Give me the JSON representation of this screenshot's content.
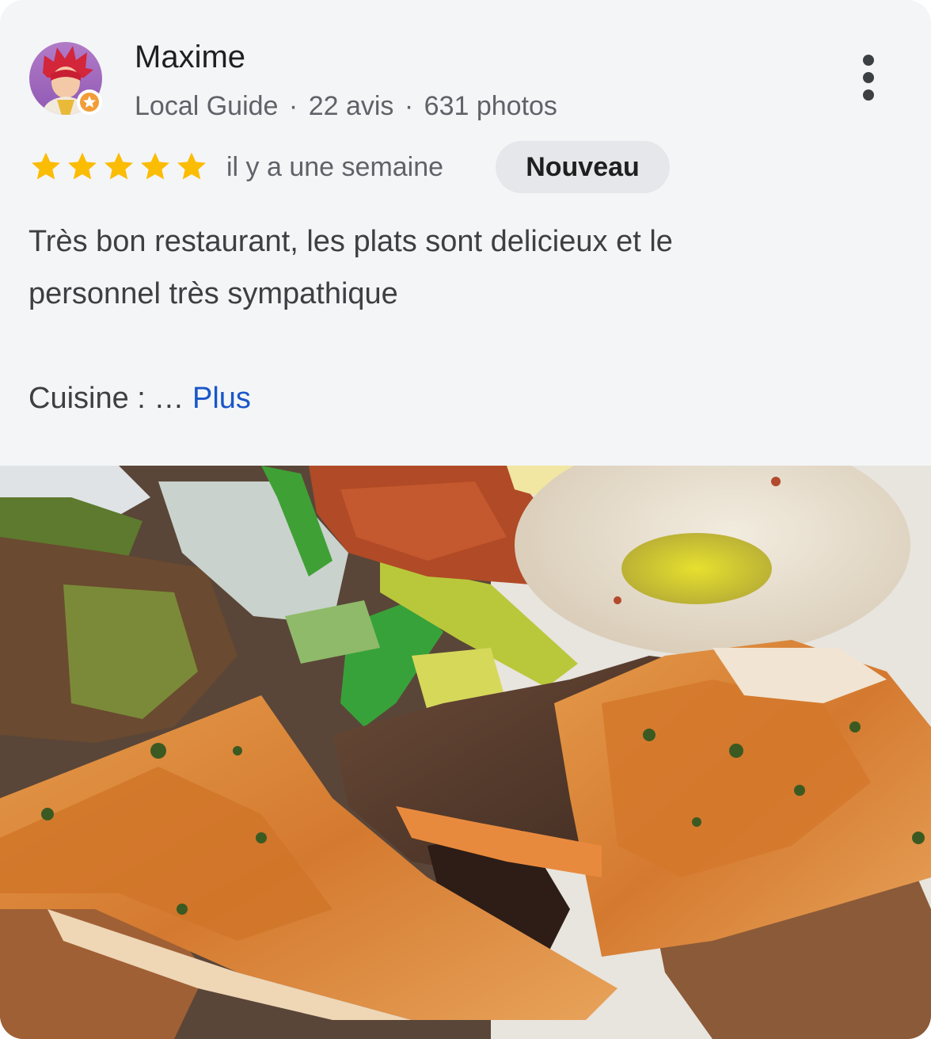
{
  "review": {
    "author": {
      "name": "Maxime",
      "role": "Local Guide",
      "separator": "·",
      "reviews_count": "22 avis",
      "photos_count": "631 photos",
      "avatar_icon": "avatar-image"
    },
    "more_options_icon": "more-vertical-icon",
    "rating": 5,
    "rating_max": 5,
    "star_color": "#fbbc04",
    "time_ago": "il y a une semaine",
    "badge_label": "Nouveau",
    "text_line1": "Très bon restaurant, les plats sont delicieux et le",
    "text_line2": "personnel très sympathique",
    "cuisine_label": "Cuisine : …",
    "more_link": "Plus",
    "link_color": "#1a56c9"
  },
  "photo": {
    "subject": "review-photo"
  }
}
